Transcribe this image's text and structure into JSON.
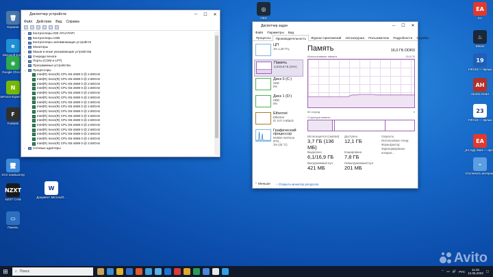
{
  "desktop_icons": [
    {
      "label": "Корзина",
      "color": "#4a78a8",
      "glyph": "🗑"
    },
    {
      "label": "Microsoft Edge",
      "color": "#1f8fd6",
      "glyph": "e"
    },
    {
      "label": "Google Chrome",
      "color": "#2da94f",
      "glyph": "◉"
    },
    {
      "label": "GeForce Experience",
      "color": "#77b900",
      "glyph": "N"
    },
    {
      "label": "FurMark",
      "color": "#303030",
      "glyph": "F"
    },
    {
      "label": "Этот компьютер",
      "color": "#3c8ad8",
      "glyph": "🖥"
    },
    {
      "label": "NZXT CAM",
      "color": "#1a1a1a",
      "glyph": "NZXT"
    },
    {
      "label": "Панель",
      "color": "#2c6fc0",
      "glyph": "▭"
    },
    {
      "label": "Документ Microsoft...",
      "color": "#ffffff",
      "glyph": "W"
    },
    {
      "label": "OBS",
      "color": "#1d2a3a",
      "glyph": "◎"
    },
    {
      "label": "EA",
      "color": "#e03a2e",
      "glyph": "EA"
    },
    {
      "label": "Steam",
      "color": "#1b2838",
      "glyph": "♨"
    },
    {
      "label": "FIFA19 — ярлык",
      "color": "#1f5fb8",
      "glyph": "19"
    },
    {
      "label": "Atomic Heart",
      "color": "#b0322a",
      "glyph": "AH"
    },
    {
      "label": "FIFA23 — ярлык",
      "color": "#ffffff",
      "glyph": "23"
    },
    {
      "label": "_EA App Start — ярлык",
      "color": "#e03a2e",
      "glyph": "EA"
    },
    {
      "label": "Отключить интернет",
      "color": "#5a9de0",
      "glyph": "⌁"
    }
  ],
  "device_manager": {
    "title": "Диспетчер устройств",
    "menu": [
      "Файл",
      "Действие",
      "Вид",
      "Справка"
    ],
    "tree": [
      {
        "label": "Контроллеры IDE ATA/ATAPI",
        "exp": "›"
      },
      {
        "label": "Контроллеры USB",
        "exp": "›"
      },
      {
        "label": "Контроллеры запоминающих устройств",
        "exp": "›"
      },
      {
        "label": "Мониторы",
        "exp": "›"
      },
      {
        "label": "Мыши и иные указывающие устройства",
        "exp": "›"
      },
      {
        "label": "Очереди печати",
        "exp": "›"
      },
      {
        "label": "Порты (COM и LPT)",
        "exp": "›"
      },
      {
        "label": "Программные устройства",
        "exp": "›"
      },
      {
        "label": "Процессоры",
        "exp": "⌄"
      }
    ],
    "processors": [
      "Intel(R) Xeon(R) CPU E5-2689 0 @ 2.60GHz",
      "Intel(R) Xeon(R) CPU E5-2689 0 @ 2.60GHz",
      "Intel(R) Xeon(R) CPU E5-2689 0 @ 2.60GHz",
      "Intel(R) Xeon(R) CPU E5-2689 0 @ 2.60GHz",
      "Intel(R) Xeon(R) CPU E5-2689 0 @ 2.60GHz",
      "Intel(R) Xeon(R) CPU E5-2689 0 @ 2.60GHz",
      "Intel(R) Xeon(R) CPU E5-2689 0 @ 2.60GHz",
      "Intel(R) Xeon(R) CPU E5-2689 0 @ 2.60GHz",
      "Intel(R) Xeon(R) CPU E5-2689 0 @ 2.60GHz",
      "Intel(R) Xeon(R) CPU E5-2689 0 @ 2.60GHz",
      "Intel(R) Xeon(R) CPU E5-2689 0 @ 2.60GHz",
      "Intel(R) Xeon(R) CPU E5-2689 0 @ 2.60GHz",
      "Intel(R) Xeon(R) CPU E5-2689 0 @ 2.60GHz",
      "Intel(R) Xeon(R) CPU E5-2689 0 @ 2.60GHz",
      "Intel(R) Xeon(R) CPU E5-2689 0 @ 2.60GHz",
      "Intel(R) Xeon(R) CPU E5-2689 0 @ 2.60GHz"
    ],
    "last_row": "Сетевые адаптеры"
  },
  "task_manager": {
    "title": "Диспетчер задач",
    "menu": [
      "Файл",
      "Параметры",
      "Вид"
    ],
    "tabs": [
      "Процессы",
      "Производительность",
      "Журнал приложений",
      "Автозагрузка",
      "Пользователи",
      "Подробности",
      "Службы"
    ],
    "active_tab": 1,
    "sidebar": [
      {
        "name": "ЦП",
        "sub1": "1% 1,20 ГГц",
        "sub2": "",
        "kind": ""
      },
      {
        "name": "Память",
        "sub1": "3,6/15,9 ГБ (24%)",
        "sub2": "",
        "kind": "mem"
      },
      {
        "name": "Диск 0 (C:)",
        "sub1": "SSD",
        "sub2": "0%",
        "kind": "dsk"
      },
      {
        "name": "Диск 1 (D:)",
        "sub1": "HDD",
        "sub2": "0%",
        "kind": "dsk"
      },
      {
        "name": "Ethernet",
        "sub1": "Ethernet",
        "sub2": "О: 0 П: 0 Кбит/с",
        "kind": "eth"
      },
      {
        "name": "Графический процессор",
        "sub1": "NVIDIA GeForce RTX...",
        "sub2": "1% (43 °C)",
        "kind": ""
      }
    ],
    "main": {
      "heading": "Память",
      "spec": "16,0 ГБ DDR3",
      "graph_caption": "Использование памяти",
      "graph_max": "15,9 ГБ",
      "graph_min": "0",
      "graph_time": "60 секунд",
      "composition_caption": "Структура памяти",
      "stats": {
        "in_use_label": "Используется (сжатая)",
        "in_use_value": "3,7 ГБ (136 МБ)",
        "available_label": "Доступно",
        "available_value": "12,1 ГБ",
        "committed_label": "Выделено",
        "committed_value": "6,1/16,9 ГБ",
        "cached_label": "Кэшировано",
        "cached_value": "7,8 ГБ",
        "paged_label": "Выгружаемый пул",
        "paged_value": "421 МБ",
        "nonpaged_label": "Невыгружаемый пул",
        "nonpaged_value": "201 МБ"
      },
      "right_labels": [
        "Скорость:",
        "Использовано гнезд:",
        "Форм-фактор:",
        "Зарезервировано аппарат..."
      ],
      "usage_series": [
        22,
        22,
        22,
        22,
        22,
        22,
        22,
        22,
        22,
        22,
        22,
        22,
        22,
        22,
        22,
        23,
        26,
        26,
        26,
        27,
        27,
        27,
        27,
        27,
        27,
        26,
        26,
        26,
        26,
        26,
        26,
        26,
        26,
        26,
        26,
        26,
        26,
        26,
        26,
        26
      ]
    },
    "footer": {
      "less": "Меньше",
      "resmon": "Открыть монитор ресурсов"
    }
  },
  "taskbar": {
    "search_placeholder": "Поиск",
    "lang": "РУС",
    "time": "11:33",
    "date": "12.06.2023",
    "apps": [
      "#c9a25c",
      "#3a8bd8",
      "#e0b030",
      "#2d6ec8",
      "#e05a2a",
      "#3aa0e0",
      "#5bb0e8",
      "#1a73d8",
      "#d83a3a",
      "#e0a82a",
      "#2a9a5a",
      "#4a88e0",
      "#e8e8e8",
      "#2fa0e8"
    ]
  },
  "watermark": "Avito"
}
